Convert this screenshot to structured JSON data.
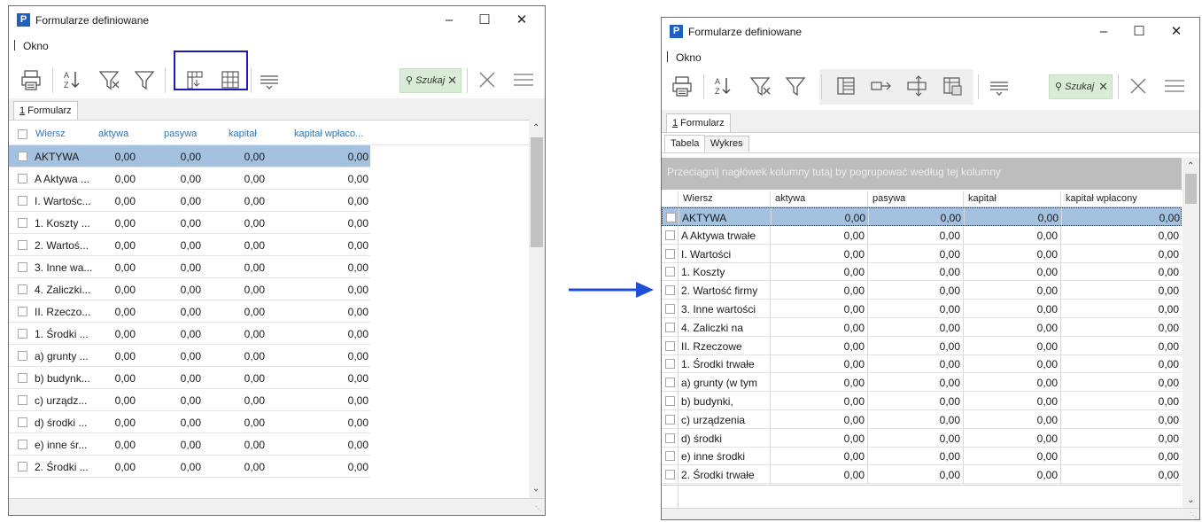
{
  "left_window": {
    "title": "Formularze definiowane",
    "app_icon_letter": "P",
    "menu": "Okno",
    "search_placeholder": "Szukaj",
    "tab": {
      "mnemonic": "1",
      "rest": " Formularz"
    },
    "columns": [
      "Wiersz",
      "aktywa",
      "pasywa",
      "kapitał",
      "kapitał wpłaco..."
    ],
    "rows": [
      {
        "label": "AKTYWA",
        "aktywa": "0,00",
        "pasywa": "0,00",
        "kapital": "0,00",
        "kapital_wplacony": "0,00",
        "selected": true
      },
      {
        "label": "A Aktywa ...",
        "aktywa": "0,00",
        "pasywa": "0,00",
        "kapital": "0,00",
        "kapital_wplacony": "0,00"
      },
      {
        "label": "I. Wartośc...",
        "aktywa": "0,00",
        "pasywa": "0,00",
        "kapital": "0,00",
        "kapital_wplacony": "0,00"
      },
      {
        "label": "1. Koszty ...",
        "aktywa": "0,00",
        "pasywa": "0,00",
        "kapital": "0,00",
        "kapital_wplacony": "0,00"
      },
      {
        "label": "2. Wartoś...",
        "aktywa": "0,00",
        "pasywa": "0,00",
        "kapital": "0,00",
        "kapital_wplacony": "0,00"
      },
      {
        "label": "3. Inne wa...",
        "aktywa": "0,00",
        "pasywa": "0,00",
        "kapital": "0,00",
        "kapital_wplacony": "0,00"
      },
      {
        "label": "4. Zaliczki...",
        "aktywa": "0,00",
        "pasywa": "0,00",
        "kapital": "0,00",
        "kapital_wplacony": "0,00"
      },
      {
        "label": "II. Rzeczo...",
        "aktywa": "0,00",
        "pasywa": "0,00",
        "kapital": "0,00",
        "kapital_wplacony": "0,00"
      },
      {
        "label": "1. Środki ...",
        "aktywa": "0,00",
        "pasywa": "0,00",
        "kapital": "0,00",
        "kapital_wplacony": "0,00"
      },
      {
        "label": "a) grunty ...",
        "aktywa": "0,00",
        "pasywa": "0,00",
        "kapital": "0,00",
        "kapital_wplacony": "0,00"
      },
      {
        "label": "b) budynk...",
        "aktywa": "0,00",
        "pasywa": "0,00",
        "kapital": "0,00",
        "kapital_wplacony": "0,00"
      },
      {
        "label": "c) urządz...",
        "aktywa": "0,00",
        "pasywa": "0,00",
        "kapital": "0,00",
        "kapital_wplacony": "0,00"
      },
      {
        "label": "d) środki ...",
        "aktywa": "0,00",
        "pasywa": "0,00",
        "kapital": "0,00",
        "kapital_wplacony": "0,00"
      },
      {
        "label": "e) inne śr...",
        "aktywa": "0,00",
        "pasywa": "0,00",
        "kapital": "0,00",
        "kapital_wplacony": "0,00"
      },
      {
        "label": "2. Środki ...",
        "aktywa": "0,00",
        "pasywa": "0,00",
        "kapital": "0,00",
        "kapital_wplacony": "0,00"
      }
    ]
  },
  "right_window": {
    "title": "Formularze definiowane",
    "app_icon_letter": "P",
    "menu": "Okno",
    "search_placeholder": "Szukaj",
    "tab": {
      "mnemonic": "1",
      "rest": " Formularz"
    },
    "subtabs": [
      "Tabela",
      "Wykres"
    ],
    "group_panel_text": "Przeciągnij nagłówek kolumny tutaj by pogrupować według tej kolumny",
    "columns": [
      "Wiersz",
      "aktywa",
      "pasywa",
      "kapitał",
      "kapitał wpłacony"
    ],
    "rows": [
      {
        "label": "AKTYWA",
        "aktywa": "0,00",
        "pasywa": "0,00",
        "kapital": "0,00",
        "kapital_wplacony": "0,00",
        "selected": true
      },
      {
        "label": "A Aktywa trwałe",
        "aktywa": "0,00",
        "pasywa": "0,00",
        "kapital": "0,00",
        "kapital_wplacony": "0,00"
      },
      {
        "label": "I. Wartości",
        "aktywa": "0,00",
        "pasywa": "0,00",
        "kapital": "0,00",
        "kapital_wplacony": "0,00"
      },
      {
        "label": "1. Koszty",
        "aktywa": "0,00",
        "pasywa": "0,00",
        "kapital": "0,00",
        "kapital_wplacony": "0,00"
      },
      {
        "label": "2. Wartość firmy",
        "aktywa": "0,00",
        "pasywa": "0,00",
        "kapital": "0,00",
        "kapital_wplacony": "0,00"
      },
      {
        "label": "3. Inne wartości",
        "aktywa": "0,00",
        "pasywa": "0,00",
        "kapital": "0,00",
        "kapital_wplacony": "0,00"
      },
      {
        "label": "4. Zaliczki na",
        "aktywa": "0,00",
        "pasywa": "0,00",
        "kapital": "0,00",
        "kapital_wplacony": "0,00"
      },
      {
        "label": "II. Rzeczowe",
        "aktywa": "0,00",
        "pasywa": "0,00",
        "kapital": "0,00",
        "kapital_wplacony": "0,00"
      },
      {
        "label": "1. Środki trwałe",
        "aktywa": "0,00",
        "pasywa": "0,00",
        "kapital": "0,00",
        "kapital_wplacony": "0,00"
      },
      {
        "label": "a) grunty (w tym",
        "aktywa": "0,00",
        "pasywa": "0,00",
        "kapital": "0,00",
        "kapital_wplacony": "0,00"
      },
      {
        "label": "b) budynki,",
        "aktywa": "0,00",
        "pasywa": "0,00",
        "kapital": "0,00",
        "kapital_wplacony": "0,00"
      },
      {
        "label": "c) urządzenia",
        "aktywa": "0,00",
        "pasywa": "0,00",
        "kapital": "0,00",
        "kapital_wplacony": "0,00"
      },
      {
        "label": "d) środki",
        "aktywa": "0,00",
        "pasywa": "0,00",
        "kapital": "0,00",
        "kapital_wplacony": "0,00"
      },
      {
        "label": "e) inne środki",
        "aktywa": "0,00",
        "pasywa": "0,00",
        "kapital": "0,00",
        "kapital_wplacony": "0,00"
      },
      {
        "label": "2. Środki trwałe",
        "aktywa": "0,00",
        "pasywa": "0,00",
        "kapital": "0,00",
        "kapital_wplacony": "0,00"
      }
    ]
  },
  "colors": {
    "accent": "#2e75b6",
    "selection": "#a4c2e0",
    "search_bg": "#d9edd6",
    "highlight_border": "#1a1ab8",
    "arrow": "#1f4fd8"
  }
}
